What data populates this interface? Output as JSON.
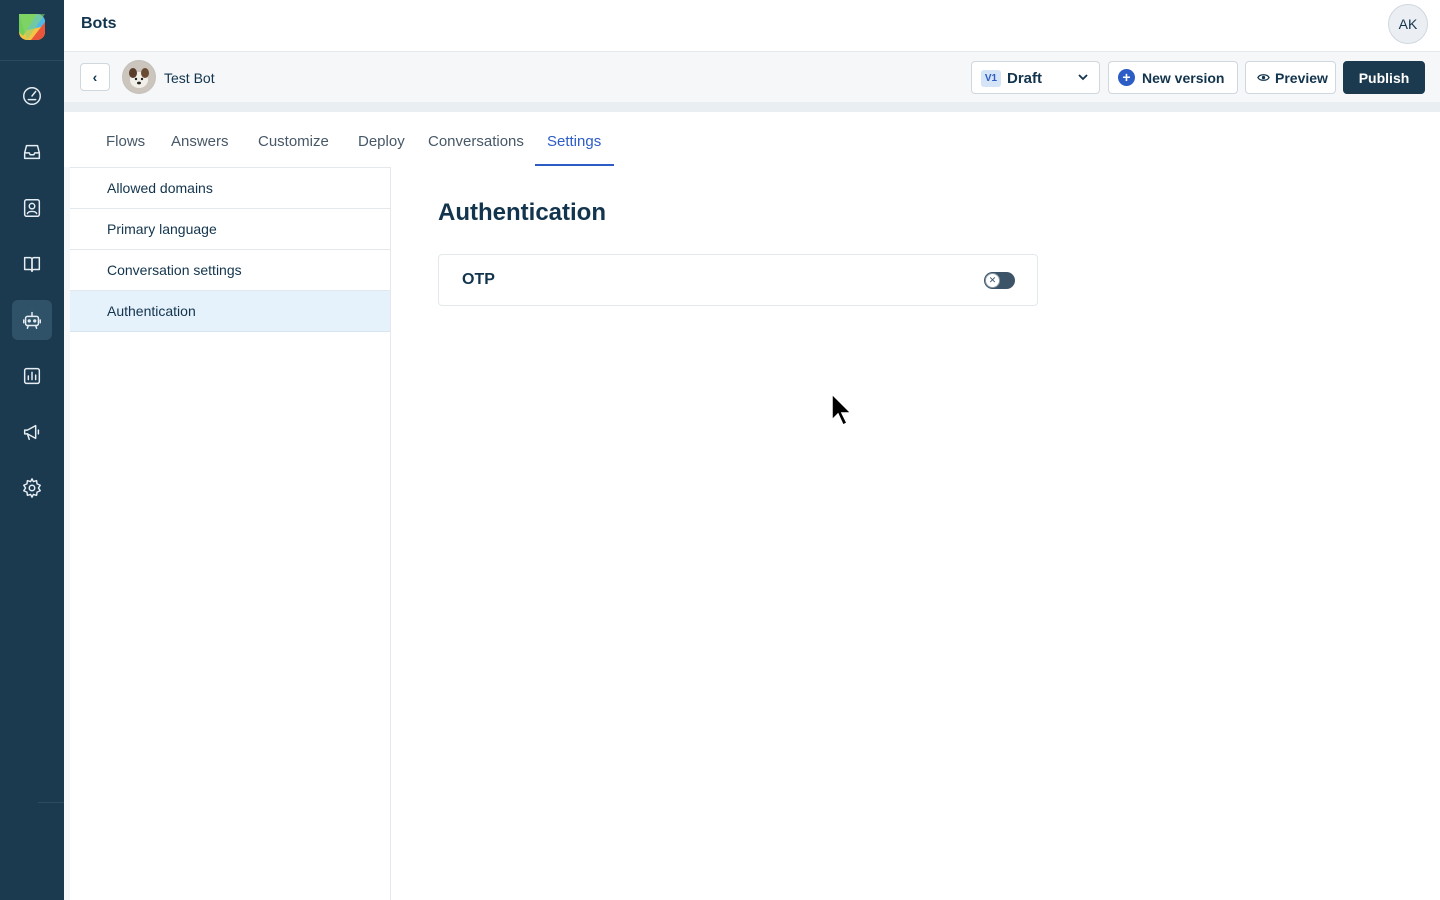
{
  "app": {
    "title": "Bots",
    "user_initials": "AK"
  },
  "rail": {
    "items": [
      {
        "name": "dashboard-icon",
        "active": false
      },
      {
        "name": "inbox-icon",
        "active": false
      },
      {
        "name": "contacts-icon",
        "active": false
      },
      {
        "name": "knowledge-base-icon",
        "active": false
      },
      {
        "name": "bots-icon",
        "active": true
      },
      {
        "name": "analytics-icon",
        "active": false
      },
      {
        "name": "campaigns-icon",
        "active": false
      },
      {
        "name": "settings-icon",
        "active": false
      }
    ]
  },
  "bot": {
    "name": "Test Bot",
    "version_badge": "V1",
    "version_state": "Draft",
    "new_version_label": "New version",
    "preview_label": "Preview",
    "publish_label": "Publish"
  },
  "tabs": [
    {
      "label": "Flows",
      "active": false
    },
    {
      "label": "Answers",
      "active": false
    },
    {
      "label": "Customize",
      "active": false
    },
    {
      "label": "Deploy",
      "active": false
    },
    {
      "label": "Conversations",
      "active": false
    },
    {
      "label": "Settings",
      "active": true
    }
  ],
  "settings_nav": [
    {
      "label": "Allowed domains",
      "active": false
    },
    {
      "label": "Primary language",
      "active": false
    },
    {
      "label": "Conversation settings",
      "active": false
    },
    {
      "label": "Authentication",
      "active": true
    }
  ],
  "content": {
    "title": "Authentication",
    "otp": {
      "label": "OTP",
      "enabled": false
    }
  },
  "colors": {
    "rail_bg": "#1b3a4f",
    "accent": "#2c5cc5",
    "active_nav_bg": "#e5f1fb",
    "publish_bg": "#1b3a4f"
  }
}
